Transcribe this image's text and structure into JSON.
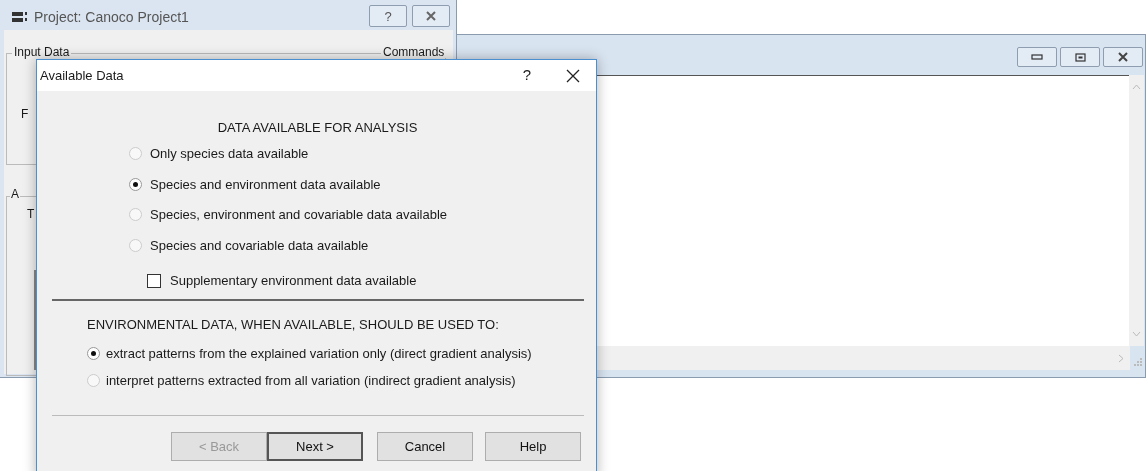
{
  "project_window": {
    "title": "Project: Canoco Project1",
    "buttons": [
      "?"
    ],
    "group_labels": [
      "Input Data",
      "Commands",
      "A"
    ],
    "fragments": [
      "F",
      "T"
    ]
  },
  "dialog": {
    "title": "Available Data",
    "help": "?",
    "section_1": {
      "heading": "DATA AVAILABLE FOR ANALYSIS",
      "options": [
        {
          "label": "Only species data available",
          "selected": false
        },
        {
          "label": "Species and environment data available",
          "selected": true
        },
        {
          "label": "Species, environment and covariable data available",
          "selected": false
        },
        {
          "label": "Species and covariable data available",
          "selected": false
        }
      ],
      "checkbox": {
        "label": "Supplementary environment data available",
        "checked": false
      }
    },
    "section_2": {
      "heading": "ENVIRONMENTAL DATA, WHEN AVAILABLE, SHOULD BE USED TO:",
      "options": [
        {
          "label": "extract patterns from the explained variation only (direct gradient analysis)",
          "selected": true
        },
        {
          "label": "interpret patterns extracted from all variation (indirect gradient analysis)",
          "selected": false
        }
      ]
    },
    "buttons": [
      {
        "label": "< Back",
        "disabled": true,
        "default": false
      },
      {
        "label": "Next >",
        "disabled": false,
        "default": true
      },
      {
        "label": "Cancel",
        "disabled": false,
        "default": false
      },
      {
        "label": "Help",
        "disabled": false,
        "default": false
      }
    ]
  }
}
